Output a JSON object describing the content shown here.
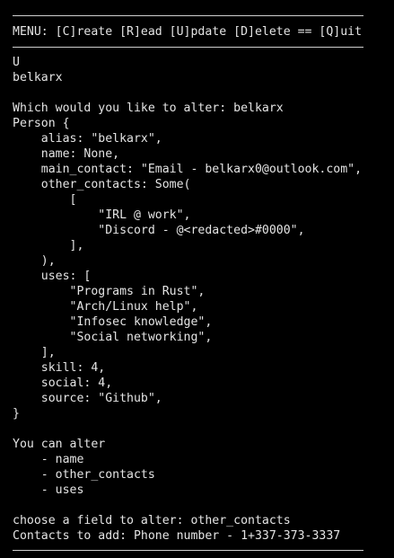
{
  "terminal": {
    "menu_line": "MENU: [C]reate [R]ead [U]pdate [D]elete == [Q]uit",
    "session_lines": [
      "U",
      "belkarx",
      "",
      "Which would you like to alter: belkarx",
      "Person {",
      "    alias: \"belkarx\",",
      "    name: None,",
      "    main_contact: \"Email - belkarx0@outlook.com\",",
      "    other_contacts: Some(",
      "        [",
      "            \"IRL @ work\",",
      "            \"Discord - @<redacted>#0000\",",
      "        ],",
      "    ),",
      "    uses: [",
      "        \"Programs in Rust\",",
      "        \"Arch/Linux help\",",
      "        \"Infosec knowledge\",",
      "        \"Social networking\",",
      "    ],",
      "    skill: 4,",
      "    social: 4,",
      "    source: \"Github\",",
      "}",
      "",
      "You can alter",
      "    - name",
      "    - other_contacts",
      "    - uses",
      "",
      "choose a field to alter: other_contacts",
      "Contacts to add: Phone number - 1+337-373-3337"
    ]
  },
  "colors": {
    "background": "#000000",
    "foreground": "#e4e4e4",
    "rule": "#cfcfcf"
  }
}
